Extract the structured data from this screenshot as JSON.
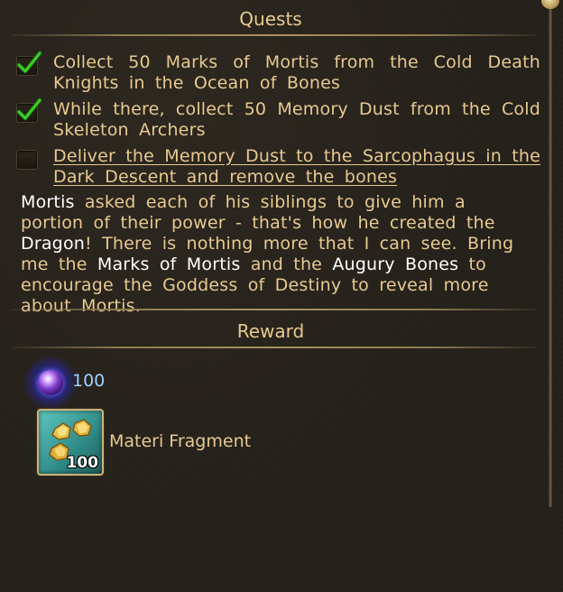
{
  "quests_section": {
    "title": "Quests"
  },
  "objectives": [
    {
      "text": "Collect 50 Marks of Mortis from the Cold Death Knights in the Ocean of Bones",
      "completed": true
    },
    {
      "text": "While there, collect 50 Memory Dust from the Cold Skeleton Archers",
      "completed": true
    },
    {
      "text": "Deliver the Memory Dust to the Sarcophagus in the Dark Descent and remove the bones",
      "completed": false
    }
  ],
  "description": {
    "p1": "Mortis",
    "p2": " asked each of his siblings to give him a portion of their power - that's how he created the ",
    "p3": "Dragon",
    "p4": "! There is nothing more that I can see. Bring me the ",
    "p5": "Marks of Mortis",
    "p6": " and the ",
    "p7": "Augury Bones",
    "p8": " to encourage the Goddess of Destiny to reveal more about Mortis."
  },
  "reward_section": {
    "title": "Reward",
    "currency": {
      "icon": "purple-gem-icon",
      "amount": "100"
    },
    "item": {
      "icon": "materi-fragment-icon",
      "count": "100",
      "name": "Materi Fragment"
    }
  },
  "colors": {
    "background": "#24201a",
    "text": "#e8c990",
    "highlight": "#ffffff",
    "currency_text": "#9fd0ff",
    "check": "#3fcf2a"
  }
}
